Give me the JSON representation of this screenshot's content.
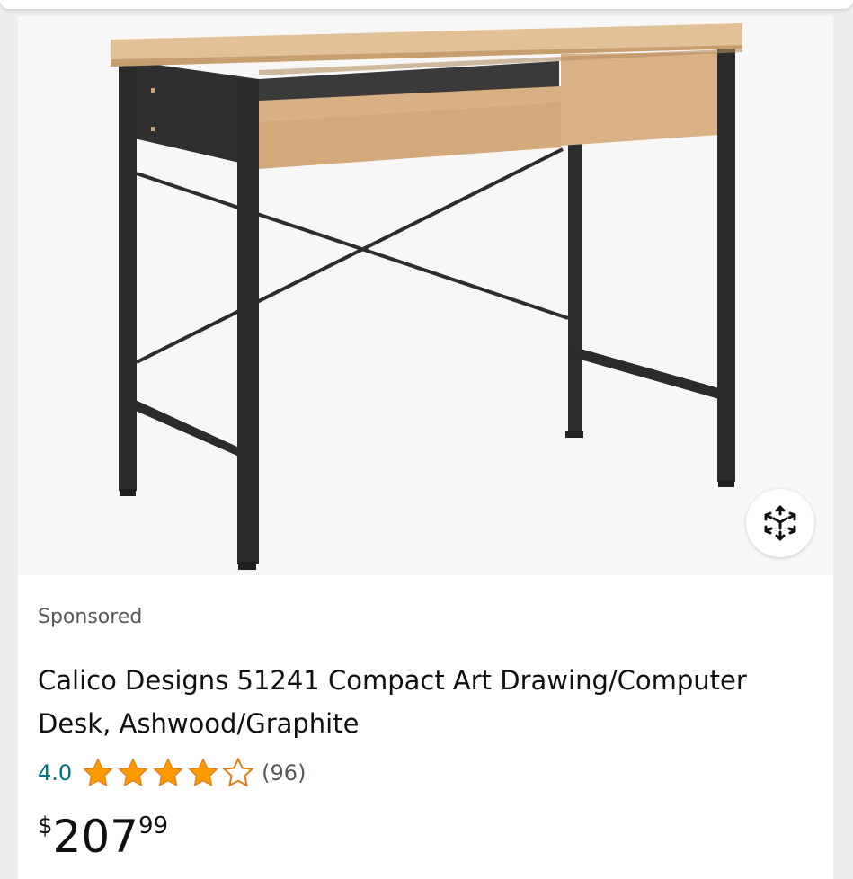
{
  "product": {
    "image_alt": "Calico Designs 51241 Compact Art Drawing/Computer Desk, Ashwood/Graphite",
    "sponsored_label": "Sponsored",
    "title": "Calico Designs 51241 Compact Art Drawing/Computer Desk, Ashwood/Graphite",
    "rating": "4.0",
    "rating_stars": 4,
    "rating_max": 5,
    "review_count": "(96)",
    "price_symbol": "$",
    "price_whole": "207",
    "price_fraction": "99"
  },
  "icons": {
    "ar_view": "view-in-3d-icon",
    "star_full": "star-full-icon",
    "star_empty": "star-empty-icon"
  },
  "colors": {
    "star_fill": "#FF9900",
    "rating_link": "#007185",
    "muted_text": "#565959",
    "body_text": "#0F1111"
  }
}
